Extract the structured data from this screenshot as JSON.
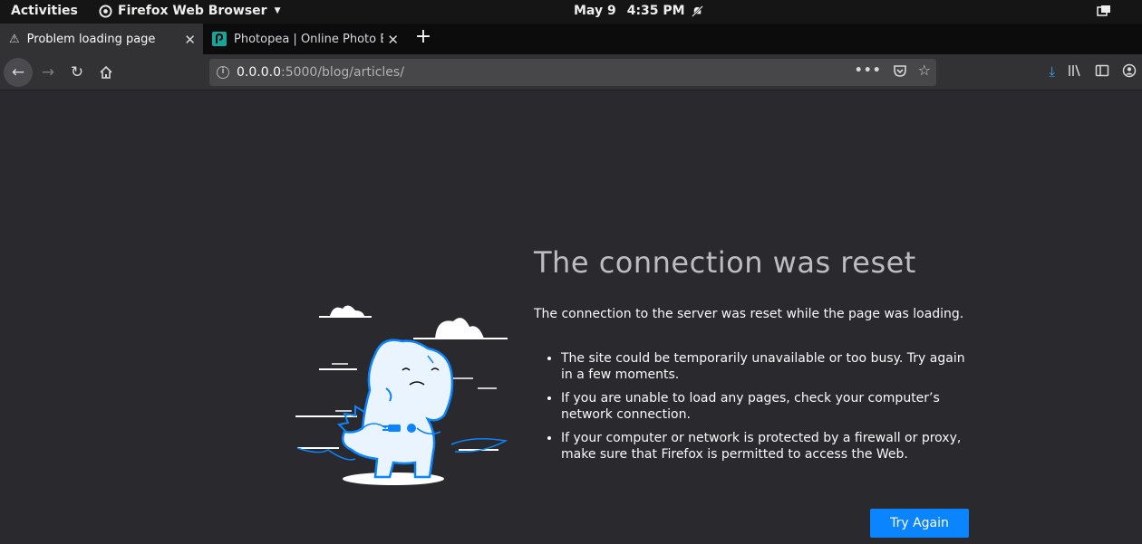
{
  "topbar": {
    "activities": "Activities",
    "app_name": "Firefox Web Browser",
    "date": "May 9",
    "time": "4:35 PM"
  },
  "tabs": [
    {
      "label": "Problem loading page",
      "icon": "warning-icon",
      "active": true
    },
    {
      "label": "Photopea | Online Photo Ed",
      "icon": "photopea-icon",
      "active": false
    }
  ],
  "navbar": {
    "url_host": "0.0.0.0",
    "url_rest": ":5000/blog/articles/"
  },
  "error": {
    "title": "The connection was reset",
    "description": "The connection to the server was reset while the page was loading.",
    "reasons": [
      "The site could be temporarily unavailable or too busy. Try again in a few moments.",
      "If you are unable to load any pages, check your computer’s network connection.",
      "If your computer or network is protected by a firewall or proxy, make sure that Firefox is permitted to access the Web."
    ],
    "button": "Try Again"
  },
  "colors": {
    "accent": "#0a84ff",
    "download": "#45a1ff",
    "page_bg": "#2a2a2e"
  }
}
